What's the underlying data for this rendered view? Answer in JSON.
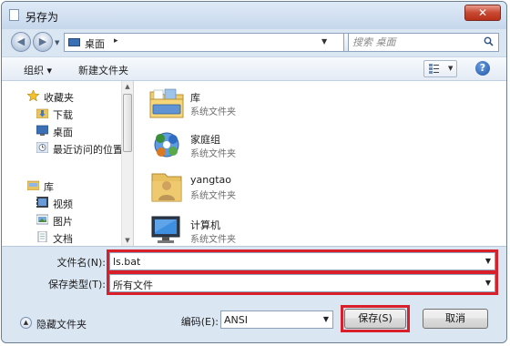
{
  "window": {
    "title": "另存为",
    "close_glyph": "✕"
  },
  "address_bar": {
    "location": "桌面",
    "separator": "▸",
    "back_glyph": "◀",
    "forward_glyph": "▶",
    "refresh_glyph": "↻",
    "search_placeholder": "搜索 桌面"
  },
  "toolbar": {
    "organize": "组织 ▾",
    "new_folder": "新建文件夹",
    "help_glyph": "?"
  },
  "sidebar": {
    "items": [
      {
        "label": "收藏夹",
        "icon": "star-icon"
      },
      {
        "label": "下载",
        "icon": "download-folder-icon"
      },
      {
        "label": "桌面",
        "icon": "desktop-icon"
      },
      {
        "label": "最近访问的位置",
        "icon": "recent-places-icon"
      },
      {
        "label": "库",
        "icon": "library-icon"
      },
      {
        "label": "视频",
        "icon": "video-icon"
      },
      {
        "label": "图片",
        "icon": "pictures-icon"
      },
      {
        "label": "文档",
        "icon": "documents-icon"
      }
    ]
  },
  "files": [
    {
      "name": "库",
      "type": "系统文件夹",
      "icon": "library-folder-icon"
    },
    {
      "name": "家庭组",
      "type": "系统文件夹",
      "icon": "homegroup-icon"
    },
    {
      "name": "yangtao",
      "type": "系统文件夹",
      "icon": "user-folder-icon"
    },
    {
      "name": "计算机",
      "type": "系统文件夹",
      "icon": "computer-icon"
    }
  ],
  "form": {
    "filename_label": "文件名(N):",
    "filename_value": "ls.bat",
    "savetype_label": "保存类型(T):",
    "savetype_value": "所有文件",
    "encoding_label": "编码(E):",
    "encoding_value": "ANSI"
  },
  "buttons": {
    "save": "保存(S)",
    "cancel": "取消",
    "hide_folders": "隐藏文件夹"
  },
  "colors": {
    "highlight_frame": "#d9202a",
    "window_bg": "#dbe6f3"
  }
}
